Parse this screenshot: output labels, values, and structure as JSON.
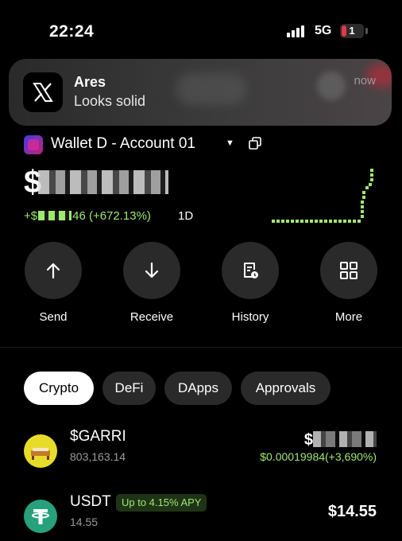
{
  "status_bar": {
    "time": "22:24",
    "network": "5G",
    "battery": "1"
  },
  "notification": {
    "app": "X",
    "title": "Ares",
    "body": "Looks solid",
    "time": "now"
  },
  "wallet": {
    "name": "Wallet D - Account 01"
  },
  "balance": {
    "prefix": "$",
    "change_prefix": "+$",
    "change_suffix": "46 (+672.13%)",
    "period": "1D"
  },
  "actions": [
    {
      "label": "Send",
      "icon": "arrow-up-icon"
    },
    {
      "label": "Receive",
      "icon": "arrow-down-icon"
    },
    {
      "label": "History",
      "icon": "history-icon"
    },
    {
      "label": "More",
      "icon": "grid-icon"
    }
  ],
  "tabs": [
    {
      "label": "Crypto",
      "active": true
    },
    {
      "label": "DeFi",
      "active": false
    },
    {
      "label": "DApps",
      "active": false
    },
    {
      "label": "Approvals",
      "active": false
    }
  ],
  "tokens": [
    {
      "symbol": "$GARRI",
      "amount": "803,163.14",
      "value": "$",
      "change": "$0.00019984(+3,690%)"
    },
    {
      "symbol": "USDT",
      "badge": "Up to 4.15% APY",
      "amount": "14.55",
      "value": "$14.55"
    }
  ],
  "colors": {
    "positive": "#9fe870",
    "background": "#000000",
    "surface": "#2a2a2a"
  }
}
